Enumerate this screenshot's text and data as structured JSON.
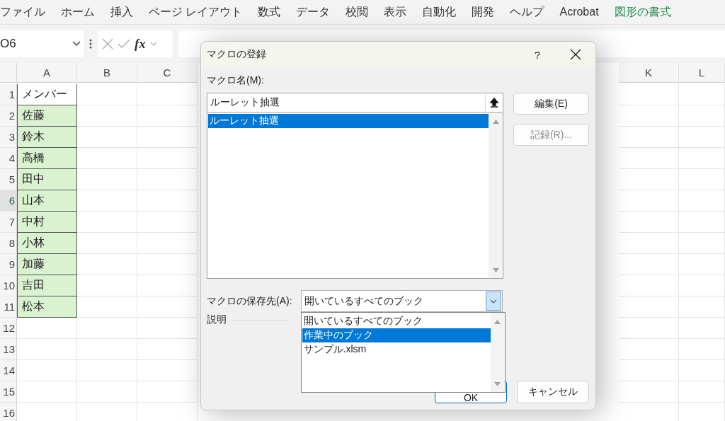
{
  "ribbon": {
    "tabs": [
      {
        "label": "ファイル",
        "kind": "normal"
      },
      {
        "label": "ホーム",
        "kind": "normal"
      },
      {
        "label": "挿入",
        "kind": "normal"
      },
      {
        "label": "ページ レイアウト",
        "kind": "normal"
      },
      {
        "label": "数式",
        "kind": "normal"
      },
      {
        "label": "データ",
        "kind": "normal"
      },
      {
        "label": "校閲",
        "kind": "normal"
      },
      {
        "label": "表示",
        "kind": "normal"
      },
      {
        "label": "自動化",
        "kind": "normal"
      },
      {
        "label": "開発",
        "kind": "normal"
      },
      {
        "label": "ヘルプ",
        "kind": "normal"
      },
      {
        "label": "Acrobat",
        "kind": "normal"
      },
      {
        "label": "図形の書式",
        "kind": "contextual"
      }
    ]
  },
  "formula_bar": {
    "name_box": "O6",
    "fx": "fx"
  },
  "sheet": {
    "columns_left": [
      "A",
      "B",
      "C"
    ],
    "columns_right": [
      "K",
      "L"
    ],
    "rows": [
      {
        "number": "1",
        "selected": false,
        "a": "メンバー",
        "kind": "header"
      },
      {
        "number": "2",
        "selected": false,
        "a": "佐藤",
        "kind": "member"
      },
      {
        "number": "3",
        "selected": false,
        "a": "鈴木",
        "kind": "member"
      },
      {
        "number": "4",
        "selected": false,
        "a": "高橋",
        "kind": "member"
      },
      {
        "number": "5",
        "selected": false,
        "a": "田中",
        "kind": "member"
      },
      {
        "number": "6",
        "selected": true,
        "a": "山本",
        "kind": "member"
      },
      {
        "number": "7",
        "selected": false,
        "a": "中村",
        "kind": "member"
      },
      {
        "number": "8",
        "selected": false,
        "a": "小林",
        "kind": "member"
      },
      {
        "number": "9",
        "selected": false,
        "a": "加藤",
        "kind": "member"
      },
      {
        "number": "10",
        "selected": false,
        "a": "吉田",
        "kind": "member"
      },
      {
        "number": "11",
        "selected": false,
        "a": "松本",
        "kind": "member"
      },
      {
        "number": "12",
        "selected": false,
        "kind": "empty"
      },
      {
        "number": "13",
        "selected": false,
        "kind": "empty"
      },
      {
        "number": "14",
        "selected": false,
        "kind": "empty"
      },
      {
        "number": "15",
        "selected": false,
        "kind": "empty"
      },
      {
        "number": "16",
        "selected": false,
        "kind": "empty"
      }
    ]
  },
  "dialog": {
    "title": "マクロの登録",
    "help": "?",
    "macro_name_label": "マクロ名(M):",
    "macro_name_value": "ルーレット抽選",
    "macros": [
      {
        "label": "ルーレット抽選",
        "selected": true
      }
    ],
    "side_buttons": [
      {
        "label": "編集(E)",
        "disabled": false
      },
      {
        "label": "記録(R)...",
        "disabled": true
      }
    ],
    "store_label": "マクロの保存先(A):",
    "store_value": "開いているすべてのブック",
    "store_expanded": true,
    "store_options": [
      {
        "label": "開いているすべてのブック",
        "selected": false
      },
      {
        "label": "作業中のブック",
        "selected": true
      },
      {
        "label": "サンプル.xlsm",
        "selected": false
      }
    ],
    "description_label": "説明",
    "buttons": [
      {
        "label": "OK",
        "default": true
      },
      {
        "label": "キャンセル",
        "default": false
      }
    ]
  }
}
